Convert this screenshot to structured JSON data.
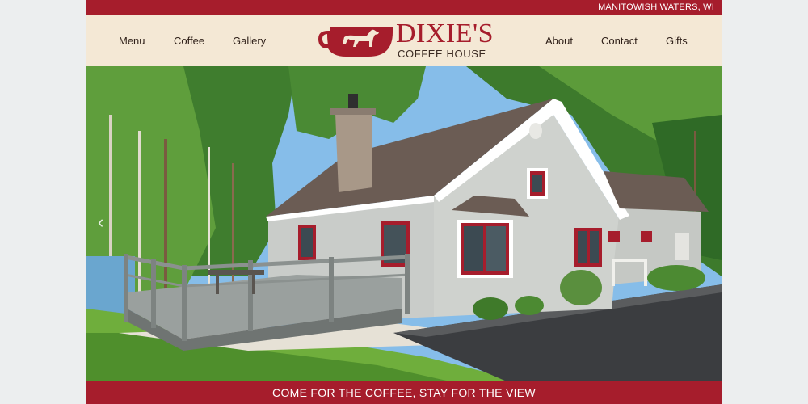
{
  "topbar": {
    "location": "MANITOWISH WATERS, WI"
  },
  "nav": {
    "left": [
      "Menu",
      "Coffee",
      "Gallery"
    ],
    "right": [
      "About",
      "Contact",
      "Gifts"
    ]
  },
  "logo": {
    "name": "DIXIE'S",
    "subtitle": "COFFEE HOUSE",
    "icon": "coffee-cup-dog-icon"
  },
  "hero": {
    "image": "cottage-photo",
    "prev_icon": "chevron-left-icon",
    "prev_glyph": "‹"
  },
  "tagline": "COME FOR THE COFFEE, STAY FOR THE VIEW",
  "colors": {
    "brand_red": "#a61d2c",
    "header_cream": "#f4e8d5",
    "nav_text": "#2e1f18"
  }
}
